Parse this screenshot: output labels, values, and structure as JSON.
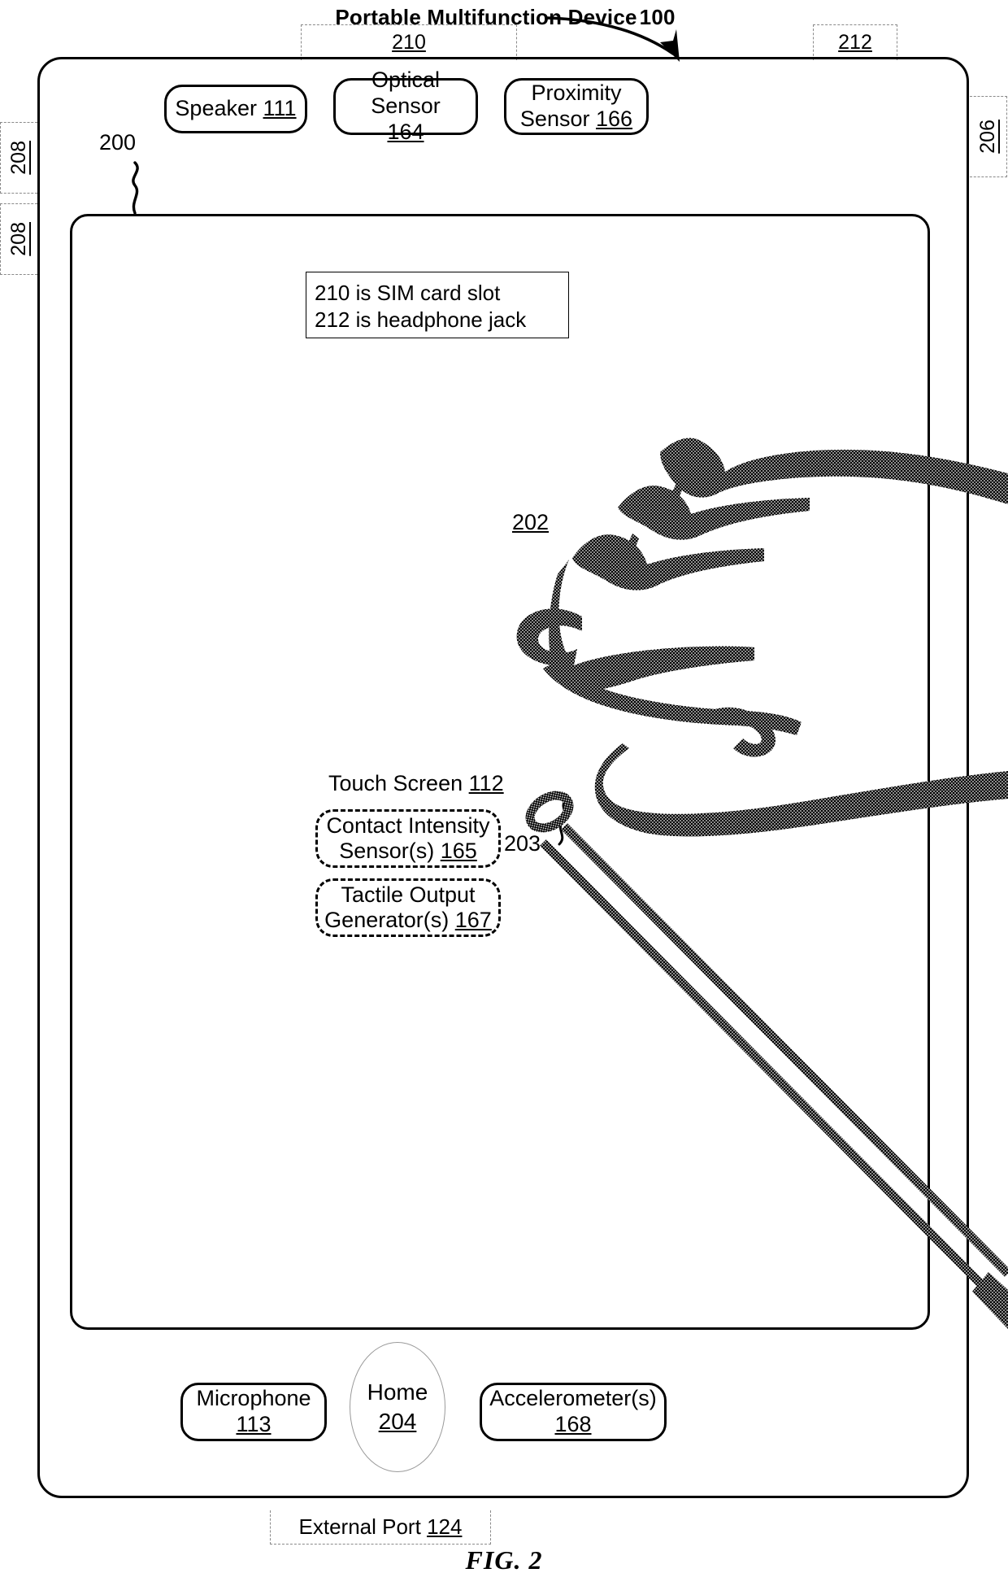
{
  "figure": {
    "title": "Portable Multifunction Device",
    "title_ref": "100",
    "caption": "FIG. 2"
  },
  "callouts": {
    "sim_slot_ref": "210",
    "headphone_jack_ref": "212",
    "side_button_right_ref": "206",
    "side_button_upper_left_ref": "208",
    "side_button_lower_left_ref": "208",
    "external_port_label": "External Port",
    "external_port_ref": "124",
    "device_screen_ref": "200",
    "finger_ref": "202",
    "stylus_ref": "203"
  },
  "note": {
    "line1": "210 is SIM card slot",
    "line2": "212 is headphone jack"
  },
  "touch_screen": {
    "label": "Touch Screen",
    "ref": "112"
  },
  "components": {
    "speaker": {
      "name": "Speaker",
      "ref": "111"
    },
    "optical_sensor": {
      "name": "Optical Sensor",
      "ref": "164"
    },
    "proximity_sensor_line1": "Proximity",
    "proximity_sensor_line2": "Sensor",
    "proximity_sensor_ref": "166",
    "contact_intensity_line1": "Contact Intensity",
    "contact_intensity_line2": "Sensor(s)",
    "contact_intensity_ref": "165",
    "tactile_output_line1": "Tactile Output",
    "tactile_output_line2": "Generator(s)",
    "tactile_output_ref": "167",
    "microphone": {
      "name": "Microphone",
      "ref": "113"
    },
    "accelerometer": {
      "name": "Accelerometer(s)",
      "ref": "168"
    },
    "home": {
      "name": "Home",
      "ref": "204"
    }
  },
  "colors": {
    "ink": "#000000",
    "dashed_callout": "#8a8a8a",
    "home_outline": "#9a9a9a",
    "background": "#ffffff"
  }
}
